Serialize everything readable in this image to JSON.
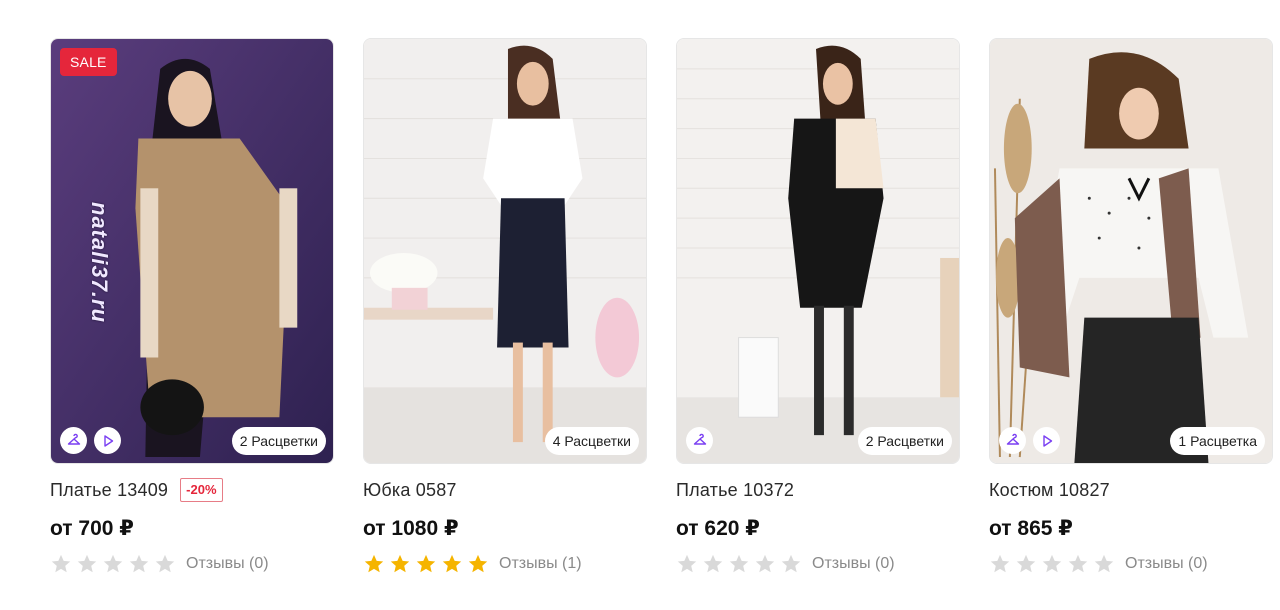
{
  "products": [
    {
      "sale_badge": "SALE",
      "name": "Платье 13409",
      "discount": "-20%",
      "price": "от 700 ₽",
      "colors_label": "2 Расцветки",
      "watermark": "natali37.ru",
      "rating": 0,
      "reviews": "Отзывы (0)",
      "actions": [
        "hanger-icon",
        "play-icon"
      ]
    },
    {
      "name": "Юбка 0587",
      "price": "от 1080 ₽",
      "colors_label": "4 Расцветки",
      "rating": 5,
      "reviews": "Отзывы (1)",
      "actions": []
    },
    {
      "name": "Платье 10372",
      "price": "от 620 ₽",
      "colors_label": "2 Расцветки",
      "rating": 0,
      "reviews": "Отзывы (0)",
      "actions": [
        "hanger-icon"
      ]
    },
    {
      "name": "Костюм 10827",
      "price": "от 865 ₽",
      "colors_label": "1 Расцветка",
      "rating": 0,
      "reviews": "Отзывы (0)",
      "actions": [
        "hanger-icon",
        "play-icon"
      ]
    }
  ],
  "colors": {
    "sale": "#e5263b",
    "star_filled": "#f5b400",
    "star_empty": "#d9d9d9",
    "action_icon": "#7a3ff2"
  }
}
